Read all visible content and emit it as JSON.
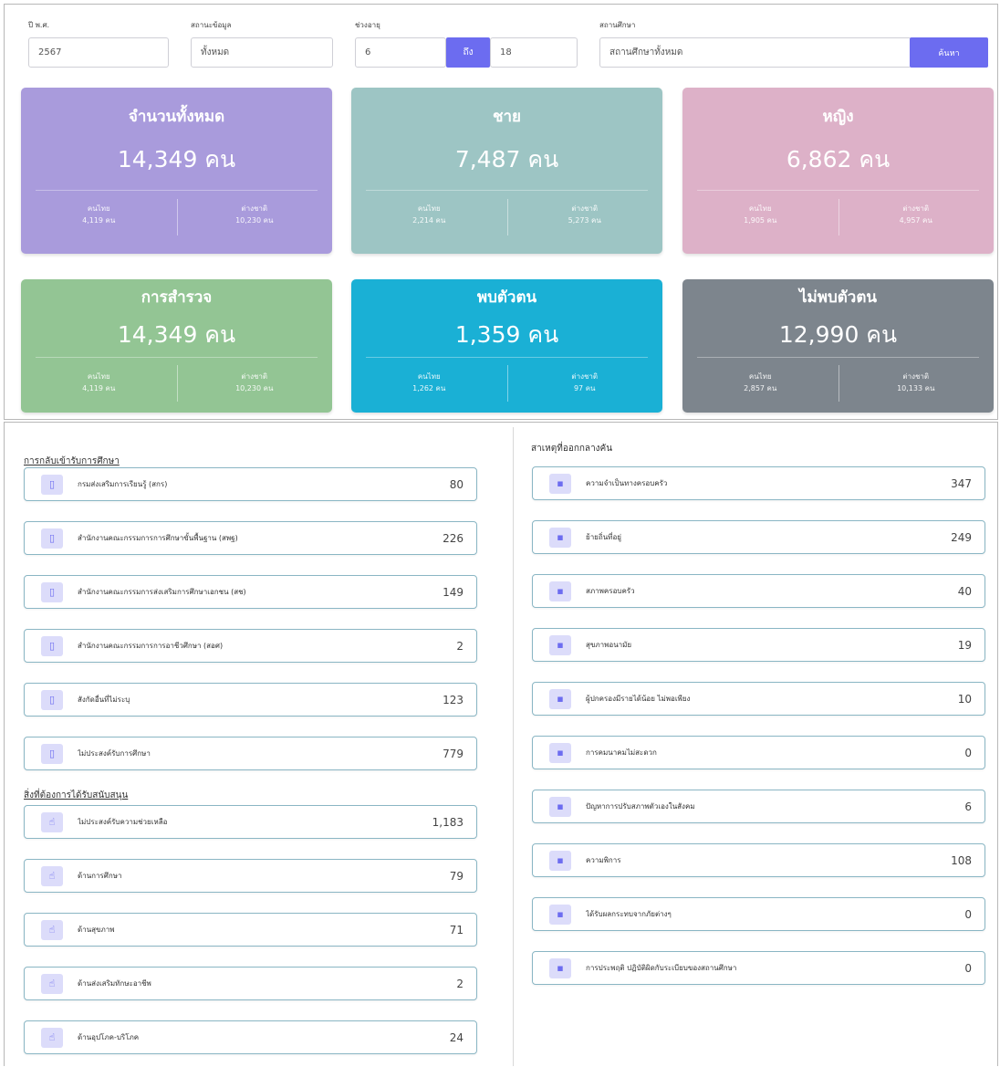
{
  "filters": {
    "year_label": "ปี พ.ศ.",
    "year_value": "2567",
    "type_label": "สถานะข้อมูล",
    "type_value": "ทั้งหมด",
    "range_label": "ช่วงอายุ",
    "range_from": "6",
    "range_to_label": "ถึง",
    "range_to": "18",
    "school_label": "สถานศึกษา",
    "school_value": "สถานศึกษาทั้งหมด",
    "search_button": "ค้นหา"
  },
  "cards": [
    {
      "title": "จำนวนทั้งหมด",
      "value": "14,349 คน",
      "left_label": "คนไทย",
      "left_value": "4,119 คน",
      "right_label": "ต่างชาติ",
      "right_value": "10,230 คน",
      "color": "#a99bdc"
    },
    {
      "title": "ชาย",
      "value": "7,487 คน",
      "left_label": "คนไทย",
      "left_value": "2,214 คน",
      "right_label": "ต่างชาติ",
      "right_value": "5,273 คน",
      "color": "#9dc5c4"
    },
    {
      "title": "หญิง",
      "value": "6,862 คน",
      "left_label": "คนไทย",
      "left_value": "1,905 คน",
      "right_label": "ต่างชาติ",
      "right_value": "4,957 คน",
      "color": "#ddb1c8"
    },
    {
      "title": "การสำรวจ",
      "value": "14,349 คน",
      "left_label": "คนไทย",
      "left_value": "4,119 คน",
      "right_label": "ต่างชาติ",
      "right_value": "10,230 คน",
      "color": "#93c594"
    },
    {
      "title": "พบตัวตน",
      "value": "1,359 คน",
      "left_label": "คนไทย",
      "left_value": "1,262 คน",
      "right_label": "ต่างชาติ",
      "right_value": "97 คน",
      "color": "#1ab0d5"
    },
    {
      "title": "ไม่พบตัวตน",
      "value": "12,990 คน",
      "left_label": "คนไทย",
      "left_value": "2,857 คน",
      "right_label": "ต่างชาติ",
      "right_value": "10,133 คน",
      "color": "#7d858d"
    }
  ],
  "left_section": {
    "title": "การกลับเข้ารับการศึกษา",
    "items": [
      {
        "label": "กรมส่งเสริมการเรียนรู้ (สกร)",
        "value": "80"
      },
      {
        "label": "สำนักงานคณะกรรมการการศึกษาขั้นพื้นฐาน (สพฐ)",
        "value": "226"
      },
      {
        "label": "สำนักงานคณะกรรมการส่งเสริมการศึกษาเอกชน (สช)",
        "value": "149"
      },
      {
        "label": "สำนักงานคณะกรรมการการอาชีวศึกษา (สอศ)",
        "value": "2"
      },
      {
        "label": "สังกัดอื่นที่ไม่ระบุ",
        "value": "123"
      },
      {
        "label": "ไม่ประสงค์รับการศึกษา",
        "value": "779"
      }
    ]
  },
  "support_section": {
    "title": "สิ่งที่ต้องการได้รับสนับสนุน",
    "items": [
      {
        "label": "ไม่ประสงค์รับความช่วยเหลือ",
        "value": "1,183"
      },
      {
        "label": "ด้านการศึกษา",
        "value": "79"
      },
      {
        "label": "ด้านสุขภาพ",
        "value": "71"
      },
      {
        "label": "ด้านส่งเสริมทักษะอาชีพ",
        "value": "2"
      },
      {
        "label": "ด้านอุปโภค-บริโภค",
        "value": "24"
      }
    ]
  },
  "right_section": {
    "title": "สาเหตุที่ออกกลางคัน",
    "items": [
      {
        "label": "ความจำเป็นทางครอบครัว",
        "value": "347"
      },
      {
        "label": "ย้ายถิ่นที่อยู่",
        "value": "249"
      },
      {
        "label": "สภาพครอบครัว",
        "value": "40"
      },
      {
        "label": "สุขภาพอนามัย",
        "value": "19"
      },
      {
        "label": "ผู้ปกครองมีรายได้น้อย ไม่พอเพียง",
        "value": "10"
      },
      {
        "label": "การคมนาคมไม่สะดวก",
        "value": "0"
      },
      {
        "label": "ปัญหาการปรับสภาพตัวเองในสังคม",
        "value": "6"
      },
      {
        "label": "ความพิการ",
        "value": "108"
      },
      {
        "label": "ได้รับผลกระทบจากภัยต่างๆ",
        "value": "0"
      },
      {
        "label": "การประพฤติ ปฏิบัติผิดกับระเบียบของสถานศึกษา",
        "value": "0"
      }
    ]
  },
  "icons": {
    "school": "tablet-icon",
    "support": "hand-icon",
    "reason": "chat-icon"
  },
  "colors": {
    "accent": "#6c6cf0",
    "row_border": "#8ab6c4"
  }
}
